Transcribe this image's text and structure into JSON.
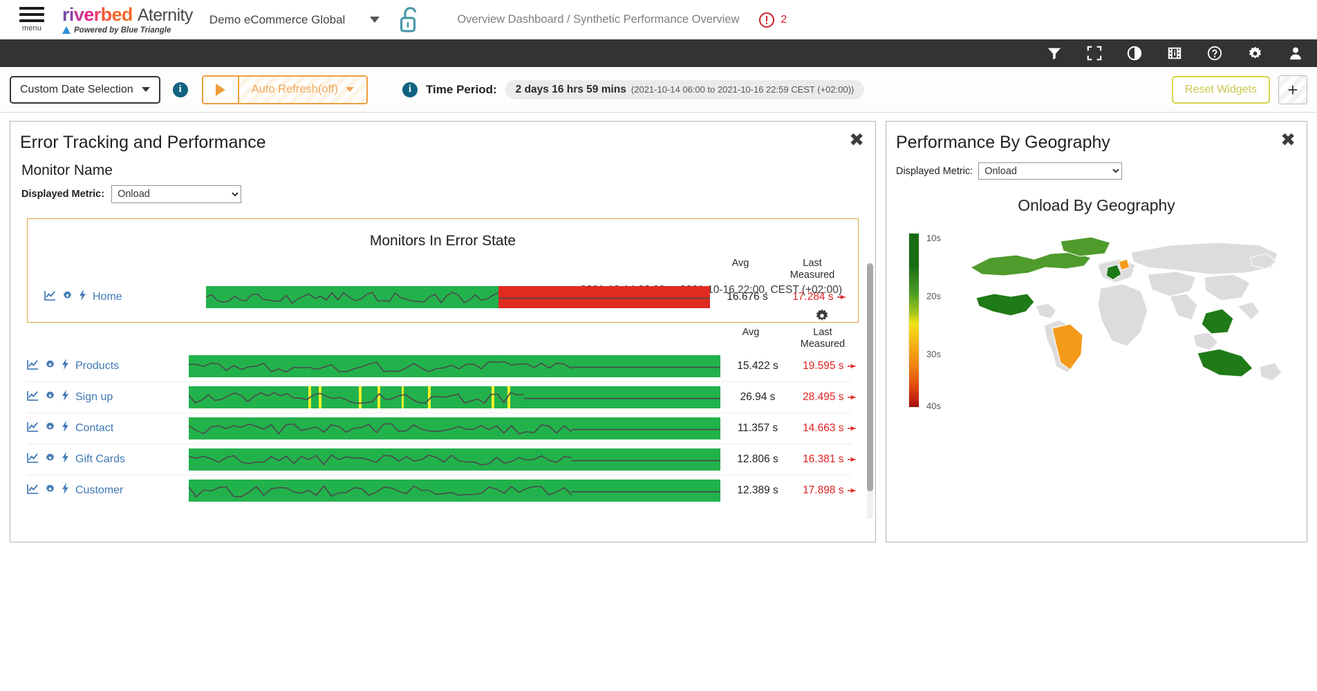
{
  "brand": {
    "menu_label": "menu",
    "logo_parts": [
      "r",
      "i",
      "v",
      "e",
      "r",
      "b",
      "e",
      "d"
    ],
    "product": "Aternity",
    "powered_by": "Powered by Blue Triangle",
    "tenant": "Demo eCommerce Global",
    "breadcrumb": "Overview Dashboard / Synthetic Performance Overview",
    "alert_count": "2"
  },
  "toolbar_icons": [
    {
      "name": "filter-icon",
      "title": "Filter"
    },
    {
      "name": "fullscreen-icon",
      "title": "Fullscreen"
    },
    {
      "name": "contrast-icon",
      "title": "Contrast"
    },
    {
      "name": "filmstrip-info-icon",
      "title": "Details"
    },
    {
      "name": "help-icon",
      "title": "Help"
    },
    {
      "name": "settings-gear-icon",
      "title": "Settings"
    },
    {
      "name": "user-avatar-icon",
      "title": "Account"
    }
  ],
  "controls": {
    "date_selection": "Custom Date Selection",
    "auto_refresh": "Auto Refresh(off)",
    "time_period_label": "Time Period:",
    "time_period_value": "2 days 16 hrs 59 mins",
    "time_period_detail": "(2021-10-14 06:00 to 2021-10-16 22:59 CEST (+02:00))",
    "reset_widgets": "Reset Widgets",
    "add_widget": "+"
  },
  "error_panel": {
    "title": "Error Tracking and Performance",
    "monitor_name_header": "Monitor Name",
    "displayed_metric_label": "Displayed Metric:",
    "displayed_metric_value": "Onload",
    "metric_options": [
      "Onload"
    ],
    "date_range": "2021-10-14 06:00 to 2021-10-16 22:00, CEST (+02:00)",
    "error_section_title": "Monitors In Error State",
    "col_avg": "Avg",
    "col_last_1": "Last",
    "col_last_2": "Measured",
    "error_rows": [
      {
        "name": "Home",
        "avg": "16.676 s",
        "last": "17.284 s",
        "trend": "up",
        "error_start_pct": 58
      }
    ],
    "rows": [
      {
        "name": "Products",
        "avg": "15.422 s",
        "last": "19.595 s",
        "trend": "up",
        "warn_marks": []
      },
      {
        "name": "Sign up",
        "avg": "26.94 s",
        "last": "28.495 s",
        "trend": "up",
        "warn_marks": [
          22.5,
          24.5,
          32,
          35.5,
          40,
          45,
          57,
          60
        ]
      },
      {
        "name": "Contact",
        "avg": "11.357 s",
        "last": "14.663 s",
        "trend": "up",
        "warn_marks": []
      },
      {
        "name": "Gift Cards",
        "avg": "12.806 s",
        "last": "16.381 s",
        "trend": "up",
        "warn_marks": []
      },
      {
        "name": "Customer",
        "avg": "12.389 s",
        "last": "17.898 s",
        "trend": "up",
        "warn_marks": []
      }
    ]
  },
  "geo_panel": {
    "title": "Performance By Geography",
    "displayed_metric_label": "Displayed Metric:",
    "displayed_metric_value": "Onload",
    "metric_options": [
      "Onload"
    ],
    "chart_title": "Onload By Geography",
    "legend_ticks": [
      "10s",
      "20s",
      "30s",
      "40s"
    ]
  },
  "chart_data": {
    "type": "heatmap",
    "title": "Onload By Geography",
    "unit": "seconds",
    "colorscale": [
      {
        "value": 10,
        "color": "#1a6b14"
      },
      {
        "value": 20,
        "color": "#4a9b26"
      },
      {
        "value": 30,
        "color": "#f5c216"
      },
      {
        "value": 40,
        "color": "#9e1208"
      }
    ],
    "axis_range": [
      10,
      40
    ],
    "legend_position": "left",
    "regions": [
      {
        "country": "United States",
        "value": 12,
        "color": "#1f7a18"
      },
      {
        "country": "Canada",
        "value": 18,
        "color": "#4f9b2c"
      },
      {
        "country": "Brazil",
        "value": 28,
        "color": "#f49a1b"
      },
      {
        "country": "France",
        "value": 13,
        "color": "#1f7a18"
      },
      {
        "country": "Germany",
        "value": 27,
        "color": "#f49a1b"
      },
      {
        "country": "India",
        "value": 12,
        "color": "#1f7a18"
      },
      {
        "country": "Australia",
        "value": 12,
        "color": "#1f7a18"
      }
    ]
  }
}
